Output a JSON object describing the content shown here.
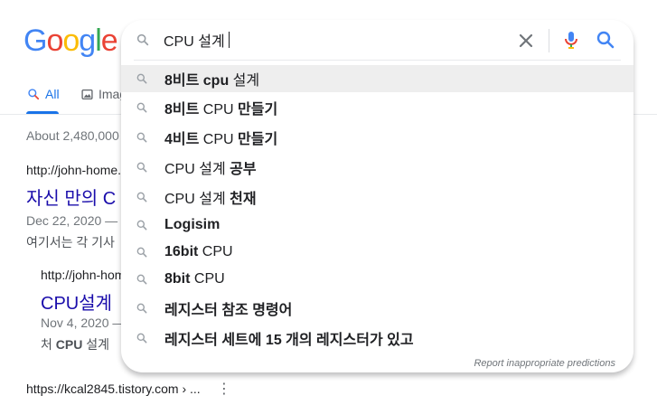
{
  "logo": {
    "letters": [
      "G",
      "o",
      "o",
      "g",
      "l",
      "e"
    ],
    "colors": [
      "#4285f4",
      "#ea4335",
      "#fbbc05",
      "#4285f4",
      "#34a853",
      "#ea4335"
    ]
  },
  "tabs": {
    "all": "All",
    "images": "Imag"
  },
  "search": {
    "query": "CPU 설계"
  },
  "suggestions": [
    {
      "parts": [
        {
          "t": "8비트 cpu",
          "b": true
        },
        {
          "t": " 설계",
          "b": false
        }
      ],
      "highlighted": true
    },
    {
      "parts": [
        {
          "t": "8비트",
          "b": true
        },
        {
          "t": " CPU ",
          "b": false
        },
        {
          "t": "만들기",
          "b": true
        }
      ],
      "highlighted": false
    },
    {
      "parts": [
        {
          "t": "4비트",
          "b": true
        },
        {
          "t": " CPU ",
          "b": false
        },
        {
          "t": "만들기",
          "b": true
        }
      ],
      "highlighted": false
    },
    {
      "parts": [
        {
          "t": "CPU 설계 ",
          "b": false
        },
        {
          "t": "공부",
          "b": true
        }
      ],
      "highlighted": false
    },
    {
      "parts": [
        {
          "t": "CPU 설계 ",
          "b": false
        },
        {
          "t": "천재",
          "b": true
        }
      ],
      "highlighted": false
    },
    {
      "parts": [
        {
          "t": "Logisim",
          "b": true
        }
      ],
      "highlighted": false
    },
    {
      "parts": [
        {
          "t": "16bit",
          "b": true
        },
        {
          "t": " CPU",
          "b": false
        }
      ],
      "highlighted": false
    },
    {
      "parts": [
        {
          "t": "8bit",
          "b": true
        },
        {
          "t": " CPU",
          "b": false
        }
      ],
      "highlighted": false
    },
    {
      "parts": [
        {
          "t": "레지스터 참조 명령어",
          "b": true
        }
      ],
      "highlighted": false
    },
    {
      "parts": [
        {
          "t": "레지스터 세트에 15 개의 레지스터가 있고",
          "b": true
        }
      ],
      "highlighted": false
    }
  ],
  "report_link": "Report inappropriate predictions",
  "results": {
    "stats": "About 2,480,000",
    "r1": {
      "url": "http://john-home.",
      "title": "자신 만의 C",
      "date": "Dec 22, 2020 —",
      "snippet": "여기서는 각 기사"
    },
    "r2": {
      "url": "http://john-home",
      "title": "CPU설계",
      "date": "Nov 4, 2020 —",
      "snippet_pre": "처 ",
      "snippet_bold": "CPU",
      "snippet_post": " 설계"
    },
    "r3": {
      "url": "https://kcal2845.tistory.com › ...",
      "menu": "⋮"
    }
  },
  "colors": {
    "link": "#1a0dab",
    "accent": "#1a73e8"
  },
  "icons": {
    "search": "search-icon",
    "clear": "close-icon",
    "mic": "mic-icon",
    "images": "image-icon"
  }
}
